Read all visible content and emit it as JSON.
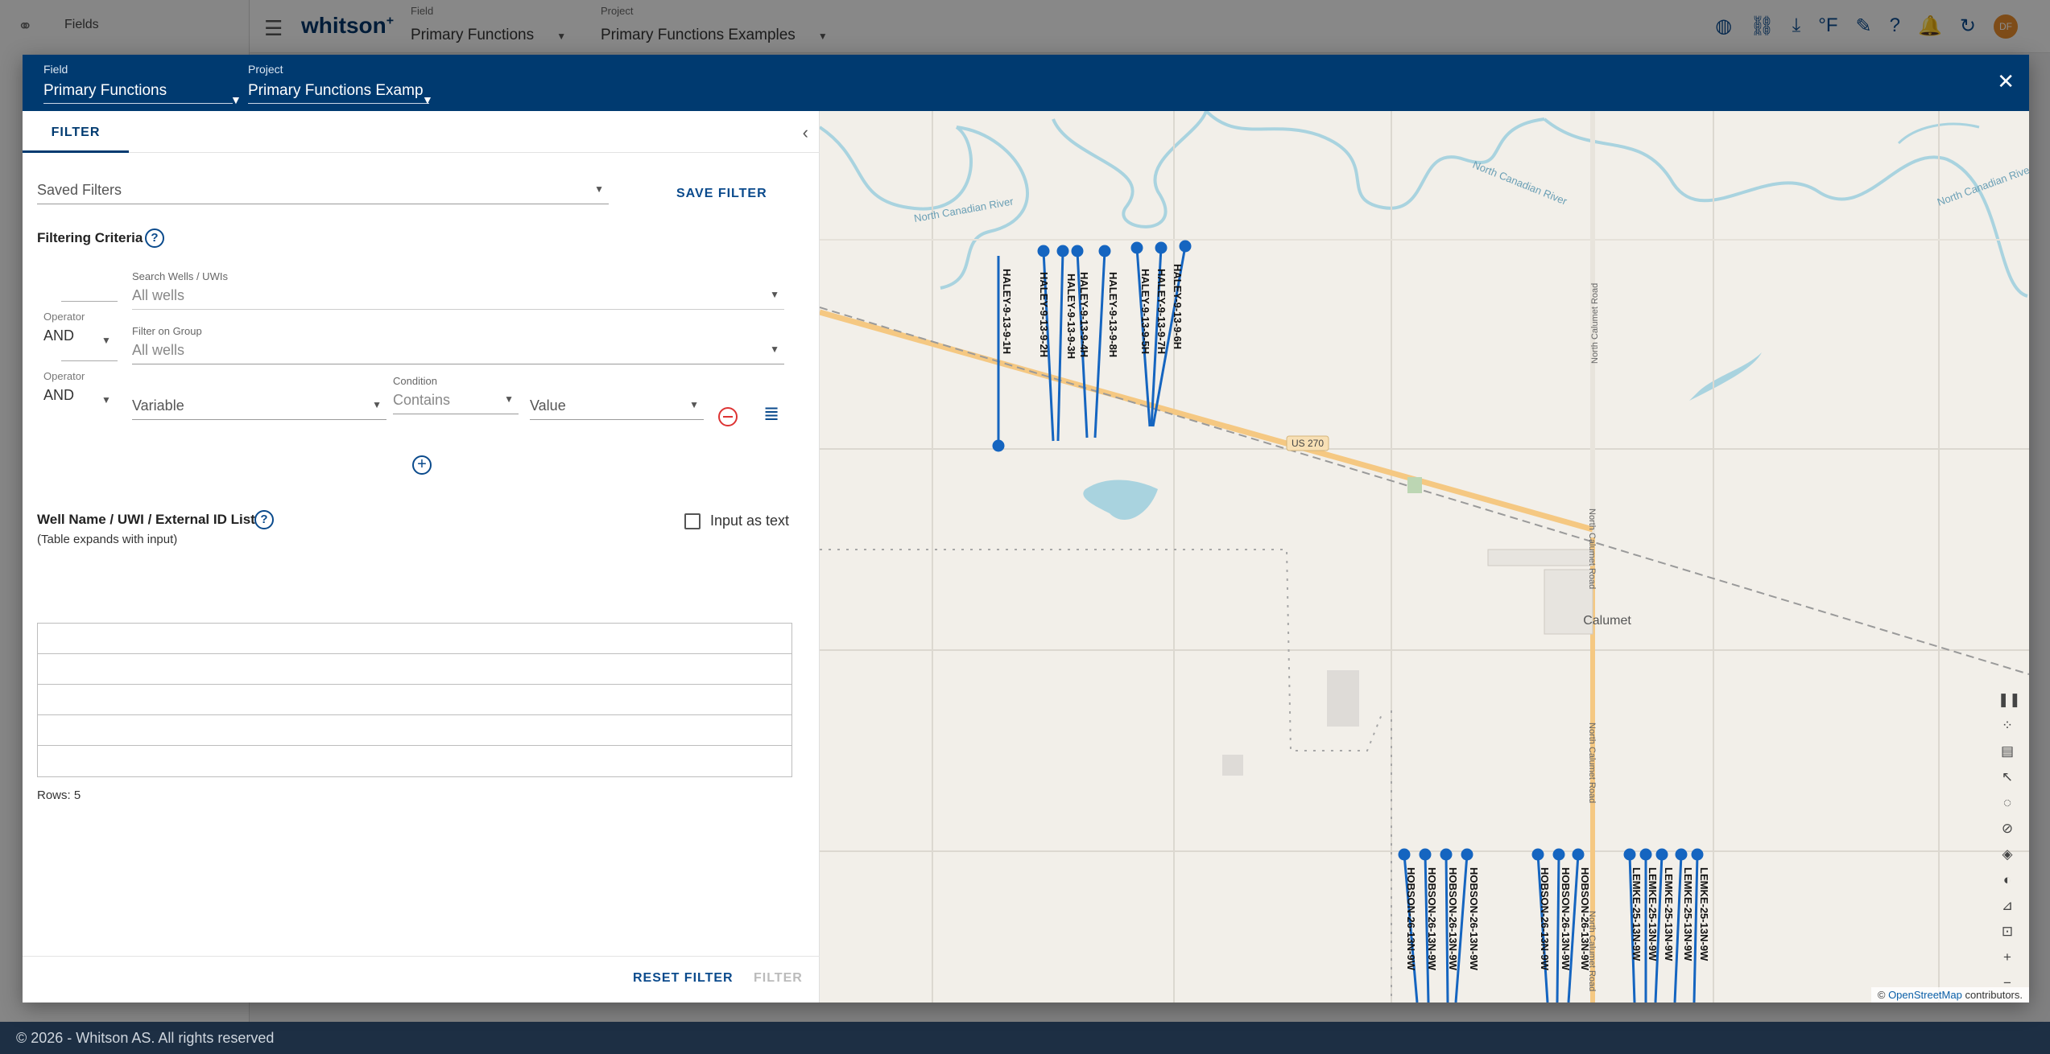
{
  "background": {
    "sidebar_title": "Fields",
    "logo": "whitson",
    "logo_sup": "+",
    "field_label": "Field",
    "field_value": "Primary Functions",
    "project_label": "Project",
    "project_value": "Primary Functions Examples",
    "avatar": "DF"
  },
  "footer": {
    "text": "© 2026 - Whitson AS. All rights reserved"
  },
  "dialog": {
    "field_label": "Field",
    "field_value": "Primary Functions",
    "project_label": "Project",
    "project_value": "Primary Functions Examp"
  },
  "filter_panel": {
    "tab": "FILTER",
    "saved_filters_placeholder": "Saved Filters",
    "save_filter": "SAVE FILTER",
    "criteria_heading": "Filtering Criteria",
    "search_wells_label": "Search Wells / UWIs",
    "search_wells_value": "All wells",
    "operator_label": "Operator",
    "operator_1": "AND",
    "group_label": "Filter on Group",
    "group_value": "All wells",
    "operator_2": "AND",
    "variable_placeholder": "Variable",
    "condition_label": "Condition",
    "condition_value": "Contains",
    "value_placeholder": "Value",
    "list_heading": "Well Name / UWI / External ID List",
    "list_sub": "(Table expands with input)",
    "input_as_text": "Input as text",
    "rows_label": "Rows: 5",
    "reset_filter": "RESET FILTER",
    "filter": "FILTER"
  },
  "map": {
    "labels": {
      "river1": "North Canadian River",
      "river2": "North Canadian River",
      "river3": "North Canadian River",
      "road1": "North Calumet Road",
      "road2": "North Calumet Road",
      "road3": "North Calumet Road",
      "road4": "North Calumet Road",
      "highway": "US 270",
      "town": "Calumet"
    },
    "wells_top": [
      "HALEY-9-13-9-1H",
      "HALEY-9-13-9-2H",
      "HALEY-9-13-9-3H",
      "HALEY-9-13-9-4H",
      "HALEY-9-13-9-8H",
      "HALEY-9-13-9-5H",
      "HALEY-9-13-9-7H",
      "HALEY-9-13-9-6H"
    ],
    "wells_bottom": [
      "HOBSON-26-13N-9W",
      "HOBSON-26-13N-9W",
      "HOBSON-26-13N-9W",
      "HOBSON-26-13N-9W",
      "HOBSON-26-13N-9W",
      "HOBSON-26-13N-9W",
      "HOBSON-26-13N-9W",
      "LEMKE-25-13N-9W",
      "LEMKE-25-13N-9W",
      "LEMKE-25-13N-9W",
      "LEMKE-25-13N-9W",
      "LEMKE-25-13N-9W"
    ],
    "attribution_prefix": "© ",
    "attribution_link": "OpenStreetMap",
    "attribution_suffix": " contributors.",
    "well_color": "#1565c0"
  }
}
